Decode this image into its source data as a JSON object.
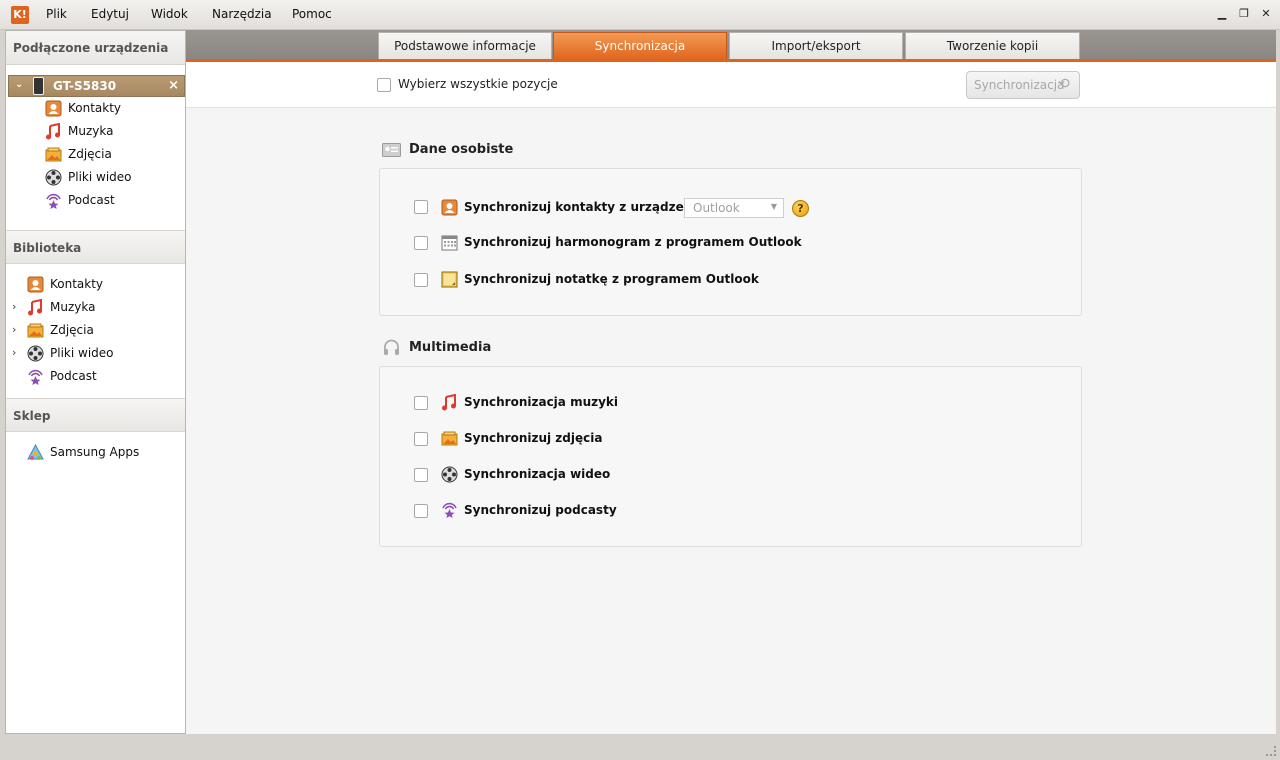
{
  "menu": {
    "logo_text": "K!",
    "items": [
      "Plik",
      "Edytuj",
      "Widok",
      "Narzędzia",
      "Pomoc"
    ],
    "minimize": "▁",
    "restore": "❐",
    "close": "✕"
  },
  "sidebar": {
    "connected_header": "Podłączone urządzenia",
    "device": {
      "name": "GT-S5830",
      "expand": "⌄",
      "close": "×"
    },
    "device_items": [
      {
        "label": "Kontakty",
        "icon": "contacts-icon"
      },
      {
        "label": "Muzyka",
        "icon": "music-icon"
      },
      {
        "label": "Zdjęcia",
        "icon": "photos-icon"
      },
      {
        "label": "Pliki wideo",
        "icon": "video-icon"
      },
      {
        "label": "Podcast",
        "icon": "podcast-icon"
      }
    ],
    "library_header": "Biblioteka",
    "library_items": [
      {
        "label": "Kontakty",
        "icon": "contacts-icon"
      },
      {
        "label": "Muzyka",
        "icon": "music-icon",
        "expandable": true
      },
      {
        "label": "Zdjęcia",
        "icon": "photos-icon",
        "expandable": true
      },
      {
        "label": "Pliki wideo",
        "icon": "video-icon",
        "expandable": true
      },
      {
        "label": "Podcast",
        "icon": "podcast-icon"
      }
    ],
    "shop_header": "Sklep",
    "shop_items": [
      {
        "label": "Samsung Apps",
        "icon": "samsung-apps-icon"
      }
    ]
  },
  "tabs": [
    {
      "label": "Podstawowe informacje",
      "active": false
    },
    {
      "label": "Synchronizacja",
      "active": true
    },
    {
      "label": "Import/eksport",
      "active": false
    },
    {
      "label": "Tworzenie kopii zapasowych...",
      "active": false
    }
  ],
  "toolbar": {
    "select_all_label": "Wybierz wszystkie pozycje",
    "sync_button_label": "Synchronizacja",
    "sync_button_icon": "⟲"
  },
  "sections": {
    "personal": {
      "title": "Dane osobiste",
      "options": [
        {
          "label": "Synchronizuj kontakty z urządzeniem",
          "icon": "contacts-icon",
          "checked": false
        },
        {
          "label": "Synchronizuj harmonogram z programem Outlook",
          "icon": "calendar-icon",
          "checked": false
        },
        {
          "label": "Synchronizuj notatkę z programem Outlook",
          "icon": "note-icon",
          "checked": false
        }
      ],
      "contacts_source": {
        "value": "Outlook",
        "arrow": "▼"
      },
      "help_label": "?"
    },
    "multimedia": {
      "title": "Multimedia",
      "options": [
        {
          "label": "Synchronizacja muzyki",
          "icon": "music-icon",
          "checked": false
        },
        {
          "label": "Synchronizuj zdjęcia",
          "icon": "photos-icon",
          "checked": false
        },
        {
          "label": "Synchronizacja wideo",
          "icon": "video-icon",
          "checked": false
        },
        {
          "label": "Synchronizuj podcasty",
          "icon": "podcast-icon",
          "checked": false
        }
      ]
    }
  },
  "colors": {
    "accent": "#e0641e",
    "device_row": "#a78961"
  }
}
